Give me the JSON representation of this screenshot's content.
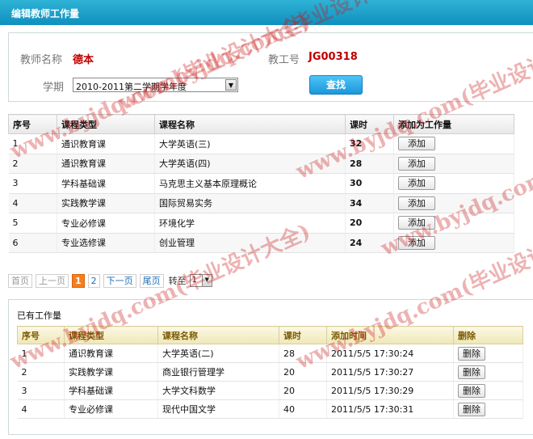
{
  "title": "编辑教师工作量",
  "teacher": {
    "name_label": "教师名称",
    "name_value": "德本",
    "id_label": "教工号",
    "id_value": "JG00318"
  },
  "semester": {
    "label": "学期",
    "selected": "2010-2011第二学期学年度"
  },
  "search_label": "查找",
  "course_table": {
    "headers": [
      "序号",
      "课程类型",
      "课程名称",
      "课时",
      "添加为工作量"
    ],
    "rows": [
      {
        "no": "1",
        "type": "通识教育课",
        "name": "大学英语(三)",
        "hours": "32",
        "action": "添加"
      },
      {
        "no": "2",
        "type": "通识教育课",
        "name": "大学英语(四)",
        "hours": "28",
        "action": "添加"
      },
      {
        "no": "3",
        "type": "学科基础课",
        "name": "马克思主义基本原理概论",
        "hours": "30",
        "action": "添加"
      },
      {
        "no": "4",
        "type": "实践教学课",
        "name": "国际贸易实务",
        "hours": "34",
        "action": "添加"
      },
      {
        "no": "5",
        "type": "专业必修课",
        "name": "环境化学",
        "hours": "20",
        "action": "添加"
      },
      {
        "no": "6",
        "type": "专业选修课",
        "name": "创业管理",
        "hours": "24",
        "action": "添加"
      }
    ]
  },
  "pager": {
    "first": "首页",
    "prev": "上一页",
    "page1": "1",
    "page2": "2",
    "next": "下一页",
    "last": "尾页",
    "goto": "转至",
    "goto_value": "1"
  },
  "existing": {
    "title": "已有工作量",
    "headers": [
      "序号",
      "课程类型",
      "课程名称",
      "课时",
      "添加时间",
      "删除"
    ],
    "rows": [
      {
        "no": "1",
        "type": "通识教育课",
        "name": "大学英语(二)",
        "hours": "28",
        "time": "2011/5/5 17:30:24",
        "action": "删除"
      },
      {
        "no": "2",
        "type": "实践教学课",
        "name": "商业银行管理学",
        "hours": "20",
        "time": "2011/5/5 17:30:27",
        "action": "删除"
      },
      {
        "no": "3",
        "type": "学科基础课",
        "name": "大学文科数学",
        "hours": "20",
        "time": "2011/5/5 17:30:29",
        "action": "删除"
      },
      {
        "no": "4",
        "type": "专业必修课",
        "name": "现代中国文学",
        "hours": "40",
        "time": "2011/5/5 17:30:31",
        "action": "删除"
      }
    ]
  },
  "watermark_texts": [
    "www.byjdq.com(毕业设计大全)",
    "www.byjdq.com(毕业设计大全)",
    "www.byjdq.com(毕业设计大全)",
    "www.byjdq.com(毕业设计大全)",
    "www.byjdq.com(毕业设计大全)",
    "www.byjdq.com(毕业设计大全)"
  ],
  "colors": {
    "titlebar": "#0f8fbd",
    "accent_red": "#c00000",
    "hours_green": "#2e9b2e",
    "pager_current": "#f57e20"
  },
  "icons": {
    "select_arrow": "chevron-down-icon"
  }
}
